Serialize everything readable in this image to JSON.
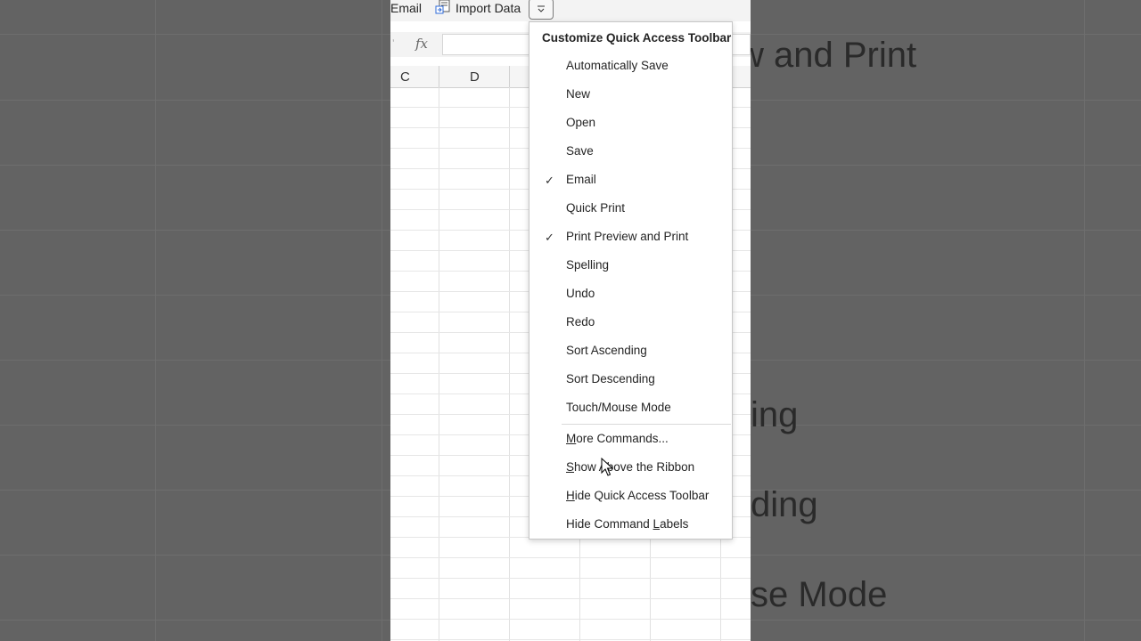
{
  "qat": {
    "email_label": "Email",
    "import_data_label": "Import Data",
    "dropdown_icon": "chevron-down-icon"
  },
  "formula_bar": {
    "fx_label": "fx"
  },
  "columns": [
    "C",
    "D"
  ],
  "menu": {
    "title": "Customize Quick Access Toolbar",
    "items": [
      {
        "label": "Automatically Save",
        "checked": false
      },
      {
        "label": "New",
        "checked": false
      },
      {
        "label": "Open",
        "checked": false
      },
      {
        "label": "Save",
        "checked": false
      },
      {
        "label": "Email",
        "checked": true
      },
      {
        "label": "Quick Print",
        "checked": false
      },
      {
        "label": "Print Preview and Print",
        "checked": true
      },
      {
        "label": "Spelling",
        "checked": false
      },
      {
        "label": "Undo",
        "checked": false
      },
      {
        "label": "Redo",
        "checked": false
      },
      {
        "label": "Sort Ascending",
        "checked": false
      },
      {
        "label": "Sort Descending",
        "checked": false
      },
      {
        "label": "Touch/Mouse Mode",
        "checked": false
      }
    ],
    "commands": [
      {
        "accel": "M",
        "rest": "ore Commands..."
      },
      {
        "accel": "S",
        "rest": "how Above the Ribbon"
      },
      {
        "accel": "H",
        "rest": "ide Quick Access Toolbar"
      },
      {
        "pre": "Hide Command ",
        "accel": "L",
        "rest": "abels"
      }
    ]
  },
  "background": {
    "fragments": [
      "w and Print",
      "ing",
      "ding",
      "se Mode"
    ]
  },
  "colors": {
    "background_dim": "#636363",
    "menu_bg": "#ffffff",
    "text": "#242424"
  }
}
